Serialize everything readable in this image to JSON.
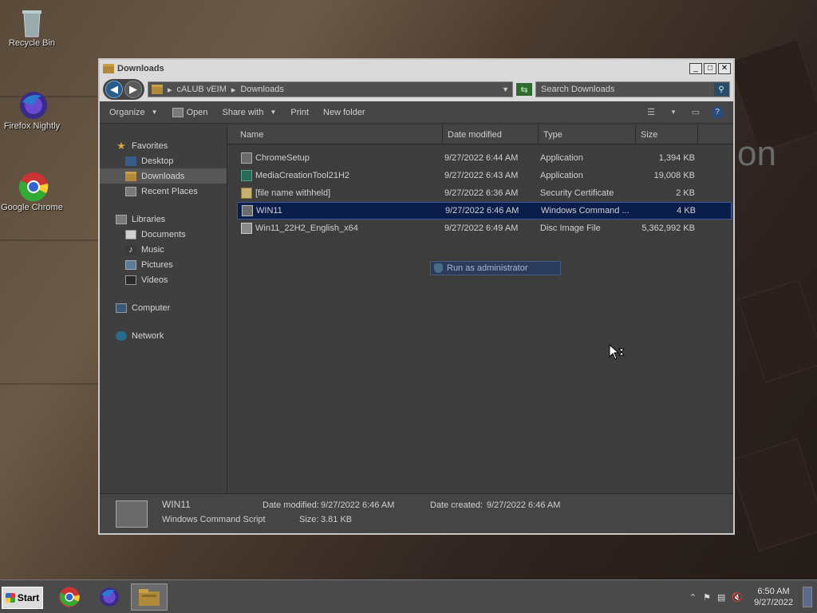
{
  "desktop": {
    "icons": [
      {
        "label": "Recycle Bin"
      },
      {
        "label": "Firefox Nightly"
      },
      {
        "label": "Google Chrome"
      }
    ],
    "background_text": "on"
  },
  "window": {
    "title": "Downloads",
    "controls": {
      "minimize": "_",
      "maximize": "□",
      "close": "✕"
    },
    "address": {
      "root": "cALUB vEIM",
      "current": "Downloads"
    },
    "search": {
      "placeholder": "Search Downloads"
    },
    "toolbar": {
      "organize": "Organize",
      "open": "Open",
      "share_with": "Share with",
      "print": "Print",
      "new_folder": "New folder"
    },
    "navpane": {
      "favorites": {
        "label": "Favorites",
        "items": [
          "Desktop",
          "Downloads",
          "Recent Places"
        ]
      },
      "libraries": {
        "label": "Libraries",
        "items": [
          "Documents",
          "Music",
          "Pictures",
          "Videos"
        ]
      },
      "computer": "Computer",
      "network": "Network"
    },
    "columns": {
      "name": "Name",
      "date": "Date modified",
      "type": "Type",
      "size": "Size"
    },
    "files": [
      {
        "name": "ChromeSetup",
        "date": "9/27/2022 6:44 AM",
        "type": "Application",
        "size": "1,394 KB"
      },
      {
        "name": "MediaCreationTool21H2",
        "date": "9/27/2022 6:43 AM",
        "type": "Application",
        "size": "19,008 KB"
      },
      {
        "name": "[file name withheld]",
        "date": "9/27/2022 6:36 AM",
        "type": "Security Certificate",
        "size": "2 KB"
      },
      {
        "name": "WIN11",
        "date": "9/27/2022 6:46 AM",
        "type": "Windows Command ...",
        "size": "4 KB"
      },
      {
        "name": "Win11_22H2_English_x64",
        "date": "9/27/2022 6:49 AM",
        "type": "Disc Image File",
        "size": "5,362,992 KB"
      }
    ],
    "context_menu": {
      "item": "Run as administrator"
    },
    "details": {
      "name": "WIN11",
      "kind": "Windows Command Script",
      "modified_label": "Date modified:",
      "modified": "9/27/2022 6:46 AM",
      "created_label": "Date created:",
      "created": "9/27/2022 6:46 AM",
      "size_label": "Size:",
      "size": "3.81 KB"
    }
  },
  "taskbar": {
    "start": "Start",
    "clock": {
      "time": "6:50 AM",
      "date": "9/27/2022"
    }
  }
}
